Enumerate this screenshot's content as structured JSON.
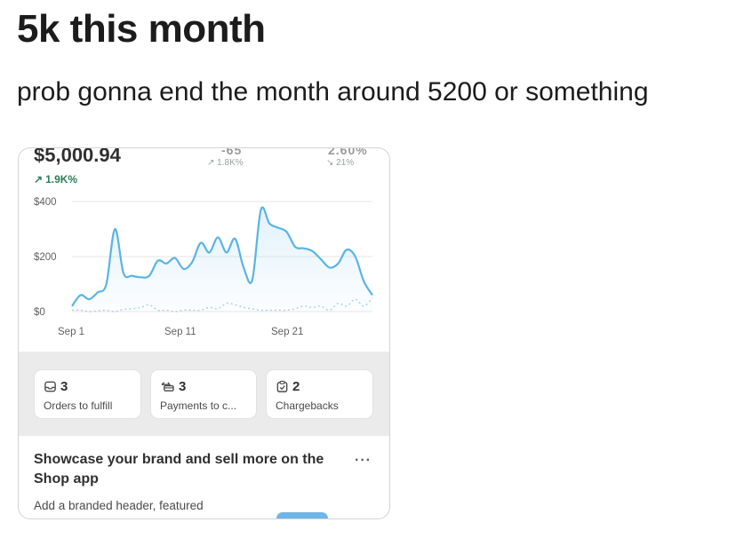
{
  "post": {
    "title": "5k this month",
    "body": "prob gonna end the month around 5200 or something"
  },
  "dashboard": {
    "total_sales": "$5,000.94",
    "total_change": "1.9K%",
    "metric2_value": "-65",
    "metric2_change": "1.8K%",
    "metric3_value": "2.60%",
    "metric3_change": "21%",
    "y_ticks": [
      "$400",
      "$200",
      "$0"
    ],
    "x_ticks": [
      "Sep 1",
      "Sep 11",
      "Sep 21"
    ],
    "colors": {
      "line": "#5ab4e5",
      "prev": "#9fd2ef",
      "positive": "#2e7d55"
    }
  },
  "chart_data": {
    "type": "area",
    "title": "",
    "xlabel": "",
    "ylabel": "",
    "ylim": [
      0,
      400
    ],
    "x_ticks": [
      "Sep 1",
      "Sep 11",
      "Sep 21"
    ],
    "series": [
      {
        "values": [
          20,
          60,
          45,
          70,
          100,
          300,
          140,
          130,
          125,
          130,
          185,
          175,
          195,
          155,
          180,
          250,
          215,
          270,
          215,
          265,
          160,
          115,
          370,
          320,
          305,
          290,
          235,
          230,
          220,
          190,
          160,
          175,
          225,
          200,
          110,
          60
        ]
      },
      {
        "values": [
          5,
          5,
          0,
          3,
          5,
          0,
          8,
          10,
          15,
          25,
          5,
          5,
          0,
          5,
          5,
          5,
          15,
          10,
          30,
          25,
          15,
          10,
          5,
          5,
          5,
          5,
          10,
          20,
          15,
          20,
          5,
          30,
          20,
          45,
          20,
          50
        ]
      }
    ]
  },
  "cards": [
    {
      "icon": "inbox-icon",
      "count": "3",
      "label": "Orders to fulfill"
    },
    {
      "icon": "payment-icon",
      "count": "3",
      "label": "Payments to c..."
    },
    {
      "icon": "chargeback-icon",
      "count": "2",
      "label": "Chargebacks"
    }
  ],
  "promo": {
    "title": "Showcase your brand and sell more on the Shop app",
    "description": "Add a branded header, featured",
    "more_icon": "more-horizontal-icon"
  }
}
